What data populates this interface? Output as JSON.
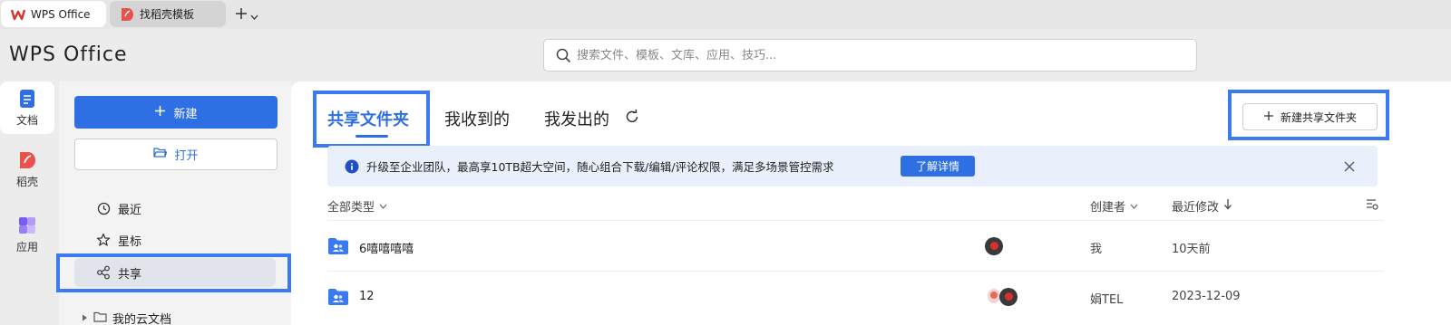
{
  "tabs": [
    {
      "label": "WPS Office",
      "icon": "wps-logo-icon",
      "color": "#d9322b"
    },
    {
      "label": "找稻壳模板",
      "icon": "docer-icon",
      "color": "#e8524a"
    }
  ],
  "brand": "WPS Office",
  "search": {
    "placeholder": "搜索文件、模板、文库、应用、技巧..."
  },
  "rail": [
    {
      "label": "文档",
      "icon": "document-icon",
      "active": true
    },
    {
      "label": "稻壳",
      "icon": "docer-icon"
    },
    {
      "label": "应用",
      "icon": "apps-icon"
    }
  ],
  "actions": {
    "new_label": "新建",
    "open_label": "打开"
  },
  "nav": [
    {
      "label": "最近",
      "icon": "clock-icon"
    },
    {
      "label": "星标",
      "icon": "star-icon"
    },
    {
      "label": "共享",
      "icon": "share-icon",
      "active": true
    }
  ],
  "tree": {
    "label": "我的云文档"
  },
  "main_tabs": [
    {
      "label": "共享文件夹",
      "active": true
    },
    {
      "label": "我收到的"
    },
    {
      "label": "我发出的"
    }
  ],
  "new_share_button": "新建共享文件夹",
  "banner": {
    "text": "升级至企业团队，最高享10TB超大空间，随心组合下载/编辑/评论权限，满足多场景管控需求",
    "button": "了解详情"
  },
  "columns": {
    "type": "全部类型",
    "creator": "创建者",
    "modified": "最近修改"
  },
  "rows": [
    {
      "name": "6嘻嘻嘻嘻",
      "creator": "我",
      "modified": "10天前"
    },
    {
      "name": "12",
      "creator": "娟TEL",
      "modified": "2023-12-09"
    }
  ],
  "colors": {
    "accent": "#2f6fe4",
    "highlight": "#3b7af0",
    "brand_red": "#d9322b"
  }
}
